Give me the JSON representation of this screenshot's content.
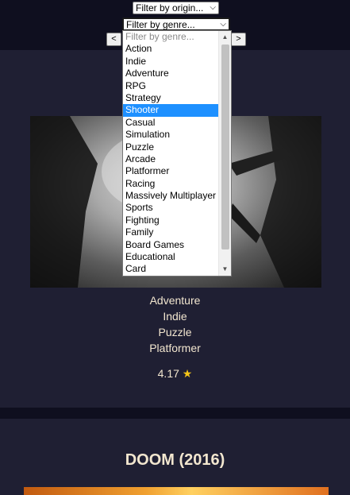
{
  "filters": {
    "origin_select": "Filter by origin...",
    "genre_select": "Filter by genre..."
  },
  "pagination": {
    "prev_label": "<",
    "next_label": ">"
  },
  "genre_dropdown": {
    "placeholder": "Filter by genre...",
    "selected": "Shooter",
    "options": [
      "Action",
      "Indie",
      "Adventure",
      "RPG",
      "Strategy",
      "Shooter",
      "Casual",
      "Simulation",
      "Puzzle",
      "Arcade",
      "Platformer",
      "Racing",
      "Massively Multiplayer",
      "Sports",
      "Fighting",
      "Family",
      "Board Games",
      "Educational",
      "Card"
    ]
  },
  "game1": {
    "genres": [
      "Adventure",
      "Indie",
      "Puzzle",
      "Platformer"
    ],
    "rating": "4.17",
    "rating_icon": "star-icon"
  },
  "game2": {
    "title": "DOOM (2016)"
  }
}
